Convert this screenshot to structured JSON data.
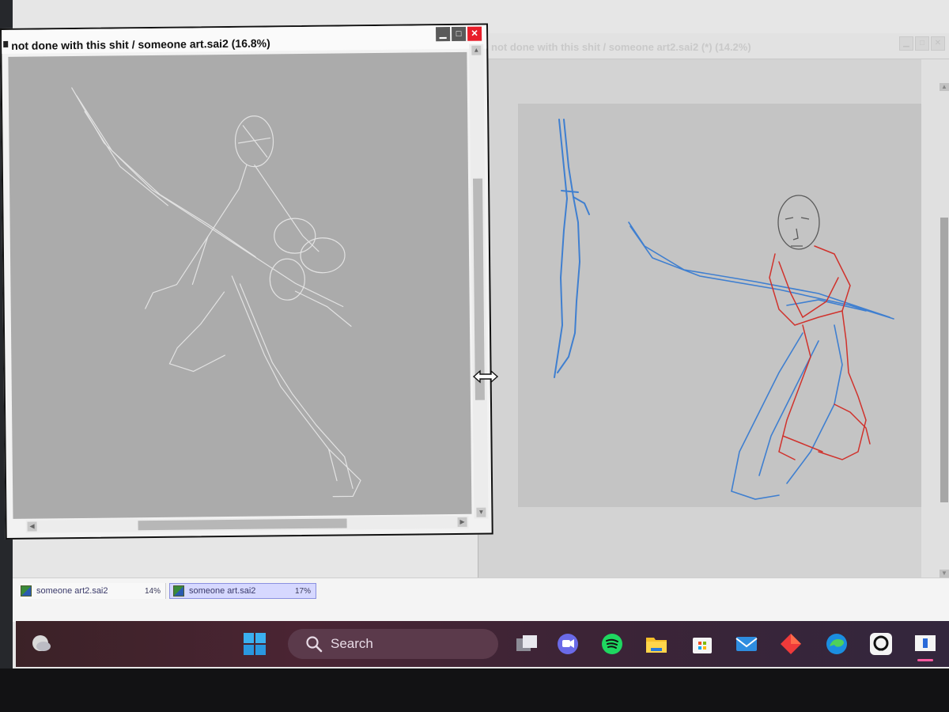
{
  "left_window": {
    "title": "not done with this shit / someone art.sai2 (16.8%)",
    "controls": {
      "minimize": "▁",
      "maximize": "□",
      "close": "✕"
    }
  },
  "right_window": {
    "title": "not done with this shit / someone art2.sai2 (*) (14.2%)",
    "controls": {
      "minimize": "▁",
      "maximize": "□",
      "close": "✕"
    }
  },
  "doc_tabs": [
    {
      "name": "someone art2.sai2",
      "zoom": "14%",
      "active": false
    },
    {
      "name": "someone art.sai2",
      "zoom": "17%",
      "active": true
    }
  ],
  "scroll": {
    "up": "▲",
    "down": "▼",
    "left": "◀",
    "right": "▶"
  },
  "taskbar": {
    "search_placeholder": "Search",
    "icons": [
      "weather-icon",
      "windows-start-icon",
      "search-icon",
      "task-view-icon",
      "teams-chat-icon",
      "spotify-icon",
      "file-explorer-icon",
      "microsoft-store-icon",
      "mail-icon",
      "red-app-icon",
      "edge-icon",
      "clip-studio-icon",
      "sai-app-icon"
    ]
  },
  "colors": {
    "sketch_blue": "#3f7fd0",
    "sketch_red": "#d0322c",
    "sketch_white": "#ececec",
    "close_red": "#e81e2a",
    "tab_active": "#d6d8ff"
  }
}
